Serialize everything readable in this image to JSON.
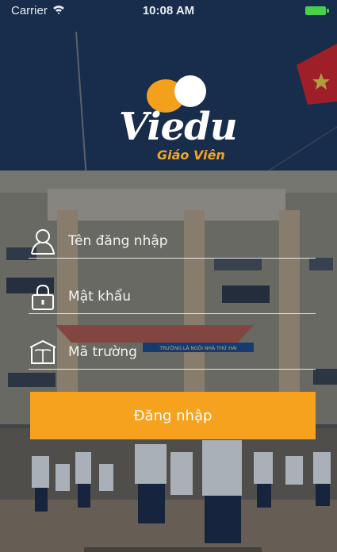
{
  "status": {
    "carrier": "Carrier",
    "time": "10:08 AM"
  },
  "logo": {
    "brand": "Viedu",
    "subtitle": "Giáo Viên"
  },
  "form": {
    "username_placeholder": "Tên đăng nhập",
    "password_placeholder": "Mật khẩu",
    "school_placeholder": "Mã trường",
    "login_label": "Đăng nhập"
  },
  "background": {
    "banner_text": "TRƯỜNG LÀ NGÔI NHÀ THỨ HAI"
  },
  "colors": {
    "accent": "#f6a21e",
    "flag": "#d8232a",
    "battery": "#47d14a"
  }
}
